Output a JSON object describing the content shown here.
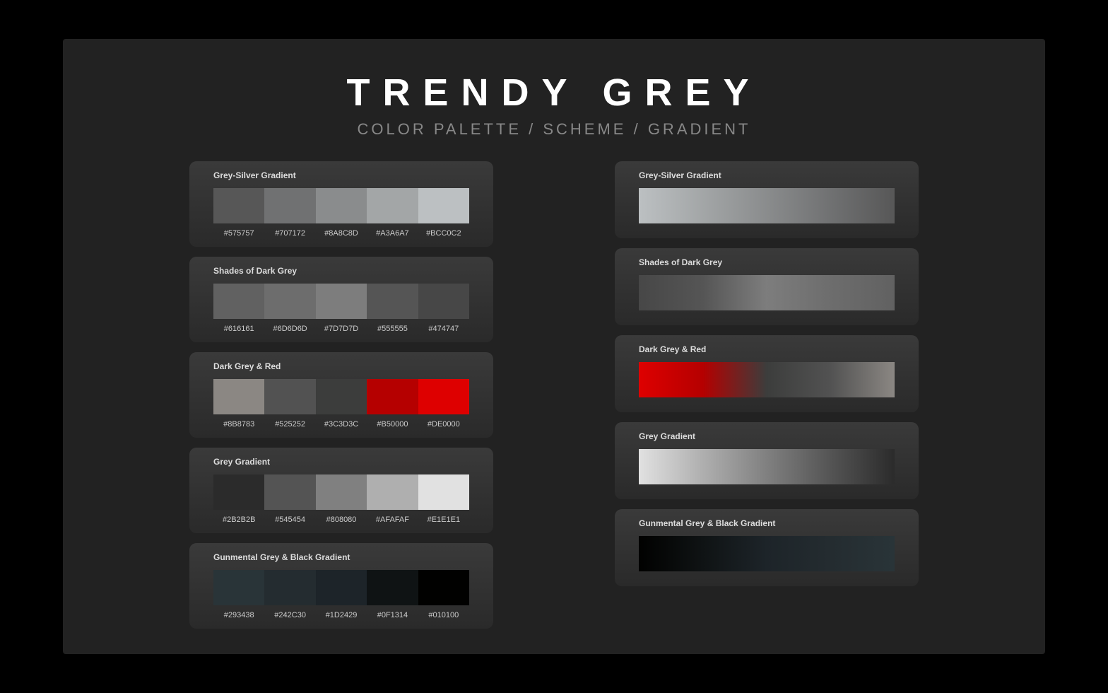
{
  "header": {
    "title": "TRENDY GREY",
    "subtitle": "Color Palette / Scheme / Gradient"
  },
  "palettes": [
    {
      "name": "Grey-Silver Gradient",
      "colors": [
        "#575757",
        "#707172",
        "#8A8C8D",
        "#A3A6A7",
        "#BCC0C2"
      ]
    },
    {
      "name": "Shades of Dark Grey",
      "colors": [
        "#616161",
        "#6D6D6D",
        "#7D7D7D",
        "#555555",
        "#474747"
      ]
    },
    {
      "name": "Dark Grey & Red",
      "colors": [
        "#8B8783",
        "#525252",
        "#3C3D3C",
        "#B50000",
        "#DE0000"
      ]
    },
    {
      "name": "Grey Gradient",
      "colors": [
        "#2B2B2B",
        "#545454",
        "#808080",
        "#AFAFAF",
        "#E1E1E1"
      ]
    },
    {
      "name": "Gunmental Grey & Black Gradient",
      "colors": [
        "#293438",
        "#242C30",
        "#1D2429",
        "#0F1314",
        "#010100"
      ]
    }
  ]
}
